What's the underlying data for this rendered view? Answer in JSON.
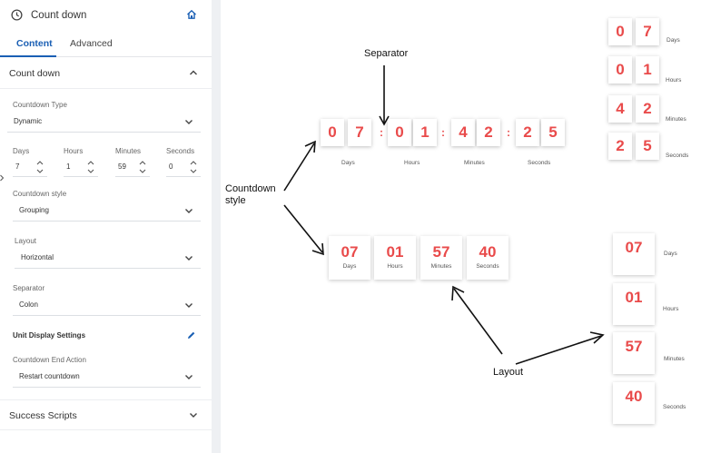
{
  "panel": {
    "title": "Count down",
    "tabs": {
      "content": "Content",
      "advanced": "Advanced"
    },
    "section_countdown": "Count down",
    "countdown_type": {
      "label": "Countdown Type",
      "value": "Dynamic"
    },
    "duration": {
      "days": {
        "label": "Days",
        "value": "7"
      },
      "hours": {
        "label": "Hours",
        "value": "1"
      },
      "minutes": {
        "label": "Minutes",
        "value": "59"
      },
      "seconds": {
        "label": "Seconds",
        "value": "0"
      }
    },
    "countdown_style": {
      "label": "Countdown style",
      "value": "Grouping"
    },
    "layout": {
      "label": "Layout",
      "value": "Horizontal"
    },
    "separator": {
      "label": "Separator",
      "value": "Colon"
    },
    "unit_display_settings": "Unit Display Settings",
    "end_action": {
      "label": "Countdown End Action",
      "value": "Restart countdown"
    },
    "section_success": "Success Scripts"
  },
  "canvas": {
    "annotations": {
      "separator": "Separator",
      "countdown_style_line1": "Countdown",
      "countdown_style_line2": "style",
      "layout": "Layout"
    },
    "separated_timer": {
      "digits": [
        "0",
        "7",
        "0",
        "1",
        "4",
        "2",
        "2",
        "5"
      ],
      "separator_char": ":",
      "labels": [
        "Days",
        "Hours",
        "Minutes",
        "Seconds"
      ]
    },
    "vertical_digits_timer": {
      "digits": [
        "0",
        "7",
        "0",
        "1",
        "4",
        "2",
        "2",
        "5"
      ],
      "labels": [
        "Days",
        "Hours",
        "Minutes",
        "Seconds"
      ]
    },
    "grouped_timer": {
      "values": [
        "07",
        "01",
        "57",
        "40"
      ],
      "labels": [
        "Days",
        "Hours",
        "Minutes",
        "Seconds"
      ]
    },
    "vertical_grouped_timer": {
      "values": [
        "07",
        "01",
        "57",
        "40"
      ],
      "labels": [
        "Days",
        "Hours",
        "Minutes",
        "Seconds"
      ]
    },
    "accent_color": "#e94b4b"
  }
}
